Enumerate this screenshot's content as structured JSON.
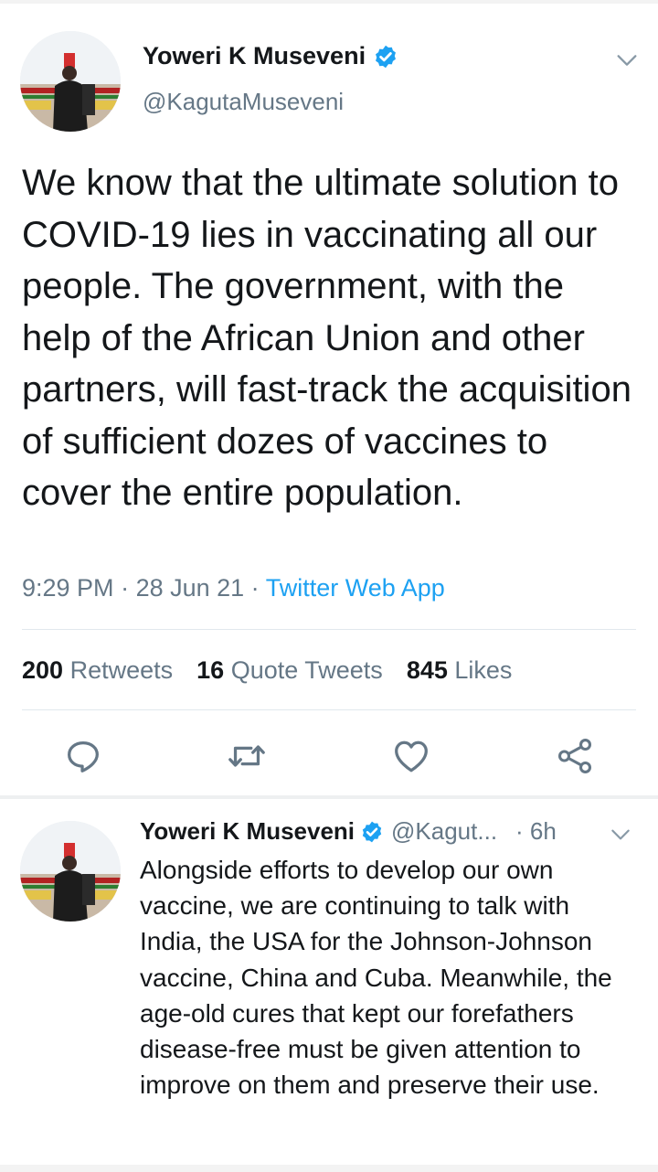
{
  "colors": {
    "accent": "#1da1f2",
    "secondary_text": "#657786",
    "primary_text": "#14171a",
    "divider": "#e1e8ed"
  },
  "main_tweet": {
    "author_name": "Yoweri K Museveni",
    "author_handle": "@KagutaMuseveni",
    "verified_icon": "verified-badge-icon",
    "menu_icon": "chevron-down-icon",
    "text": "We know that the ultimate solution to COVID-19 lies in vaccinating all our people. The government, with the help of the African Union and other partners, will fast-track the acquisition of sufficient dozes of vaccines to cover the entire population.",
    "time": "9:29 PM",
    "date": "28 Jun 21",
    "separator": " · ",
    "source": "Twitter Web App",
    "stats": {
      "retweets_count": "200",
      "retweets_label": "Retweets",
      "quote_tweets_count": "16",
      "quote_tweets_label": "Quote Tweets",
      "likes_count": "845",
      "likes_label": "Likes"
    },
    "actions": [
      "reply-icon",
      "retweet-icon",
      "like-icon",
      "share-icon"
    ]
  },
  "reply_tweet": {
    "author_name": "Yoweri K Museveni",
    "author_handle": "@Kagut...",
    "time": "· 6h",
    "verified_icon": "verified-badge-icon",
    "menu_icon": "chevron-down-icon",
    "text": "Alongside efforts to develop our own vaccine, we are continuing to talk with India, the USA for the Johnson-Johnson vaccine, China and Cuba.  Meanwhile, the age-old cures that kept our forefathers disease-free must be given attention to improve on them and preserve their use."
  }
}
